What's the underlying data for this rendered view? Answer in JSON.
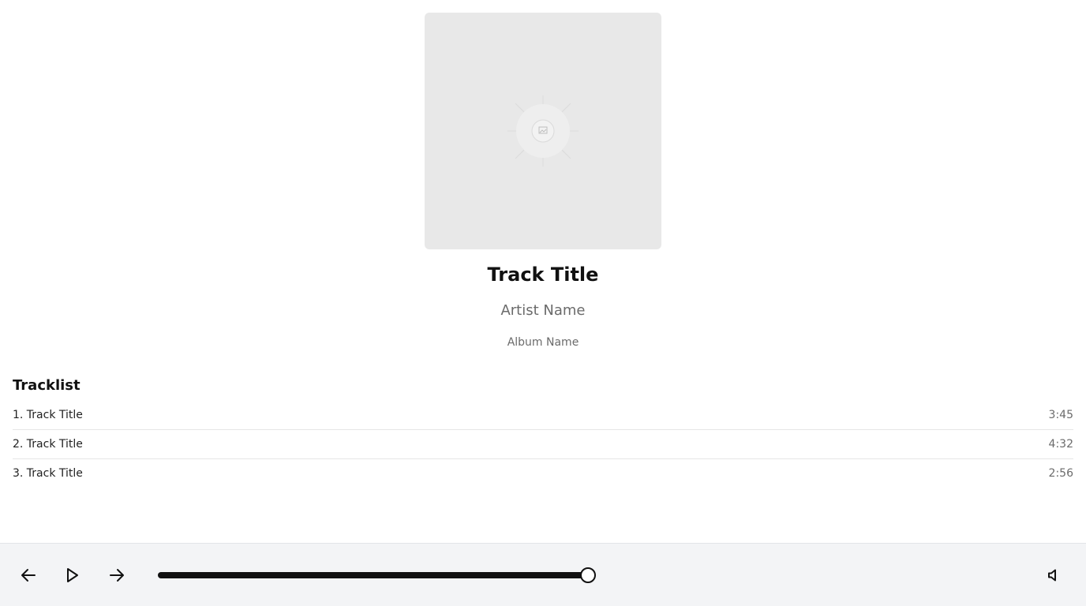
{
  "now_playing": {
    "cover_icon": "image-placeholder-icon",
    "title": "Track Title",
    "artist": "Artist Name",
    "album": "Album Name"
  },
  "tracklist": {
    "heading": "Tracklist",
    "tracks": [
      {
        "label": "1. Track Title",
        "duration": "3:45"
      },
      {
        "label": "2. Track Title",
        "duration": "4:32"
      },
      {
        "label": "3. Track Title",
        "duration": "2:56"
      }
    ]
  },
  "player": {
    "prev_icon": "arrow-left-icon",
    "play_icon": "play-icon",
    "next_icon": "arrow-right-icon",
    "volume_icon": "volume-icon",
    "progress_fraction": 1.0
  },
  "colors": {
    "accent": "#111111",
    "bar_background": "#f3f4f6",
    "muted_text": "#6b6b6b"
  }
}
